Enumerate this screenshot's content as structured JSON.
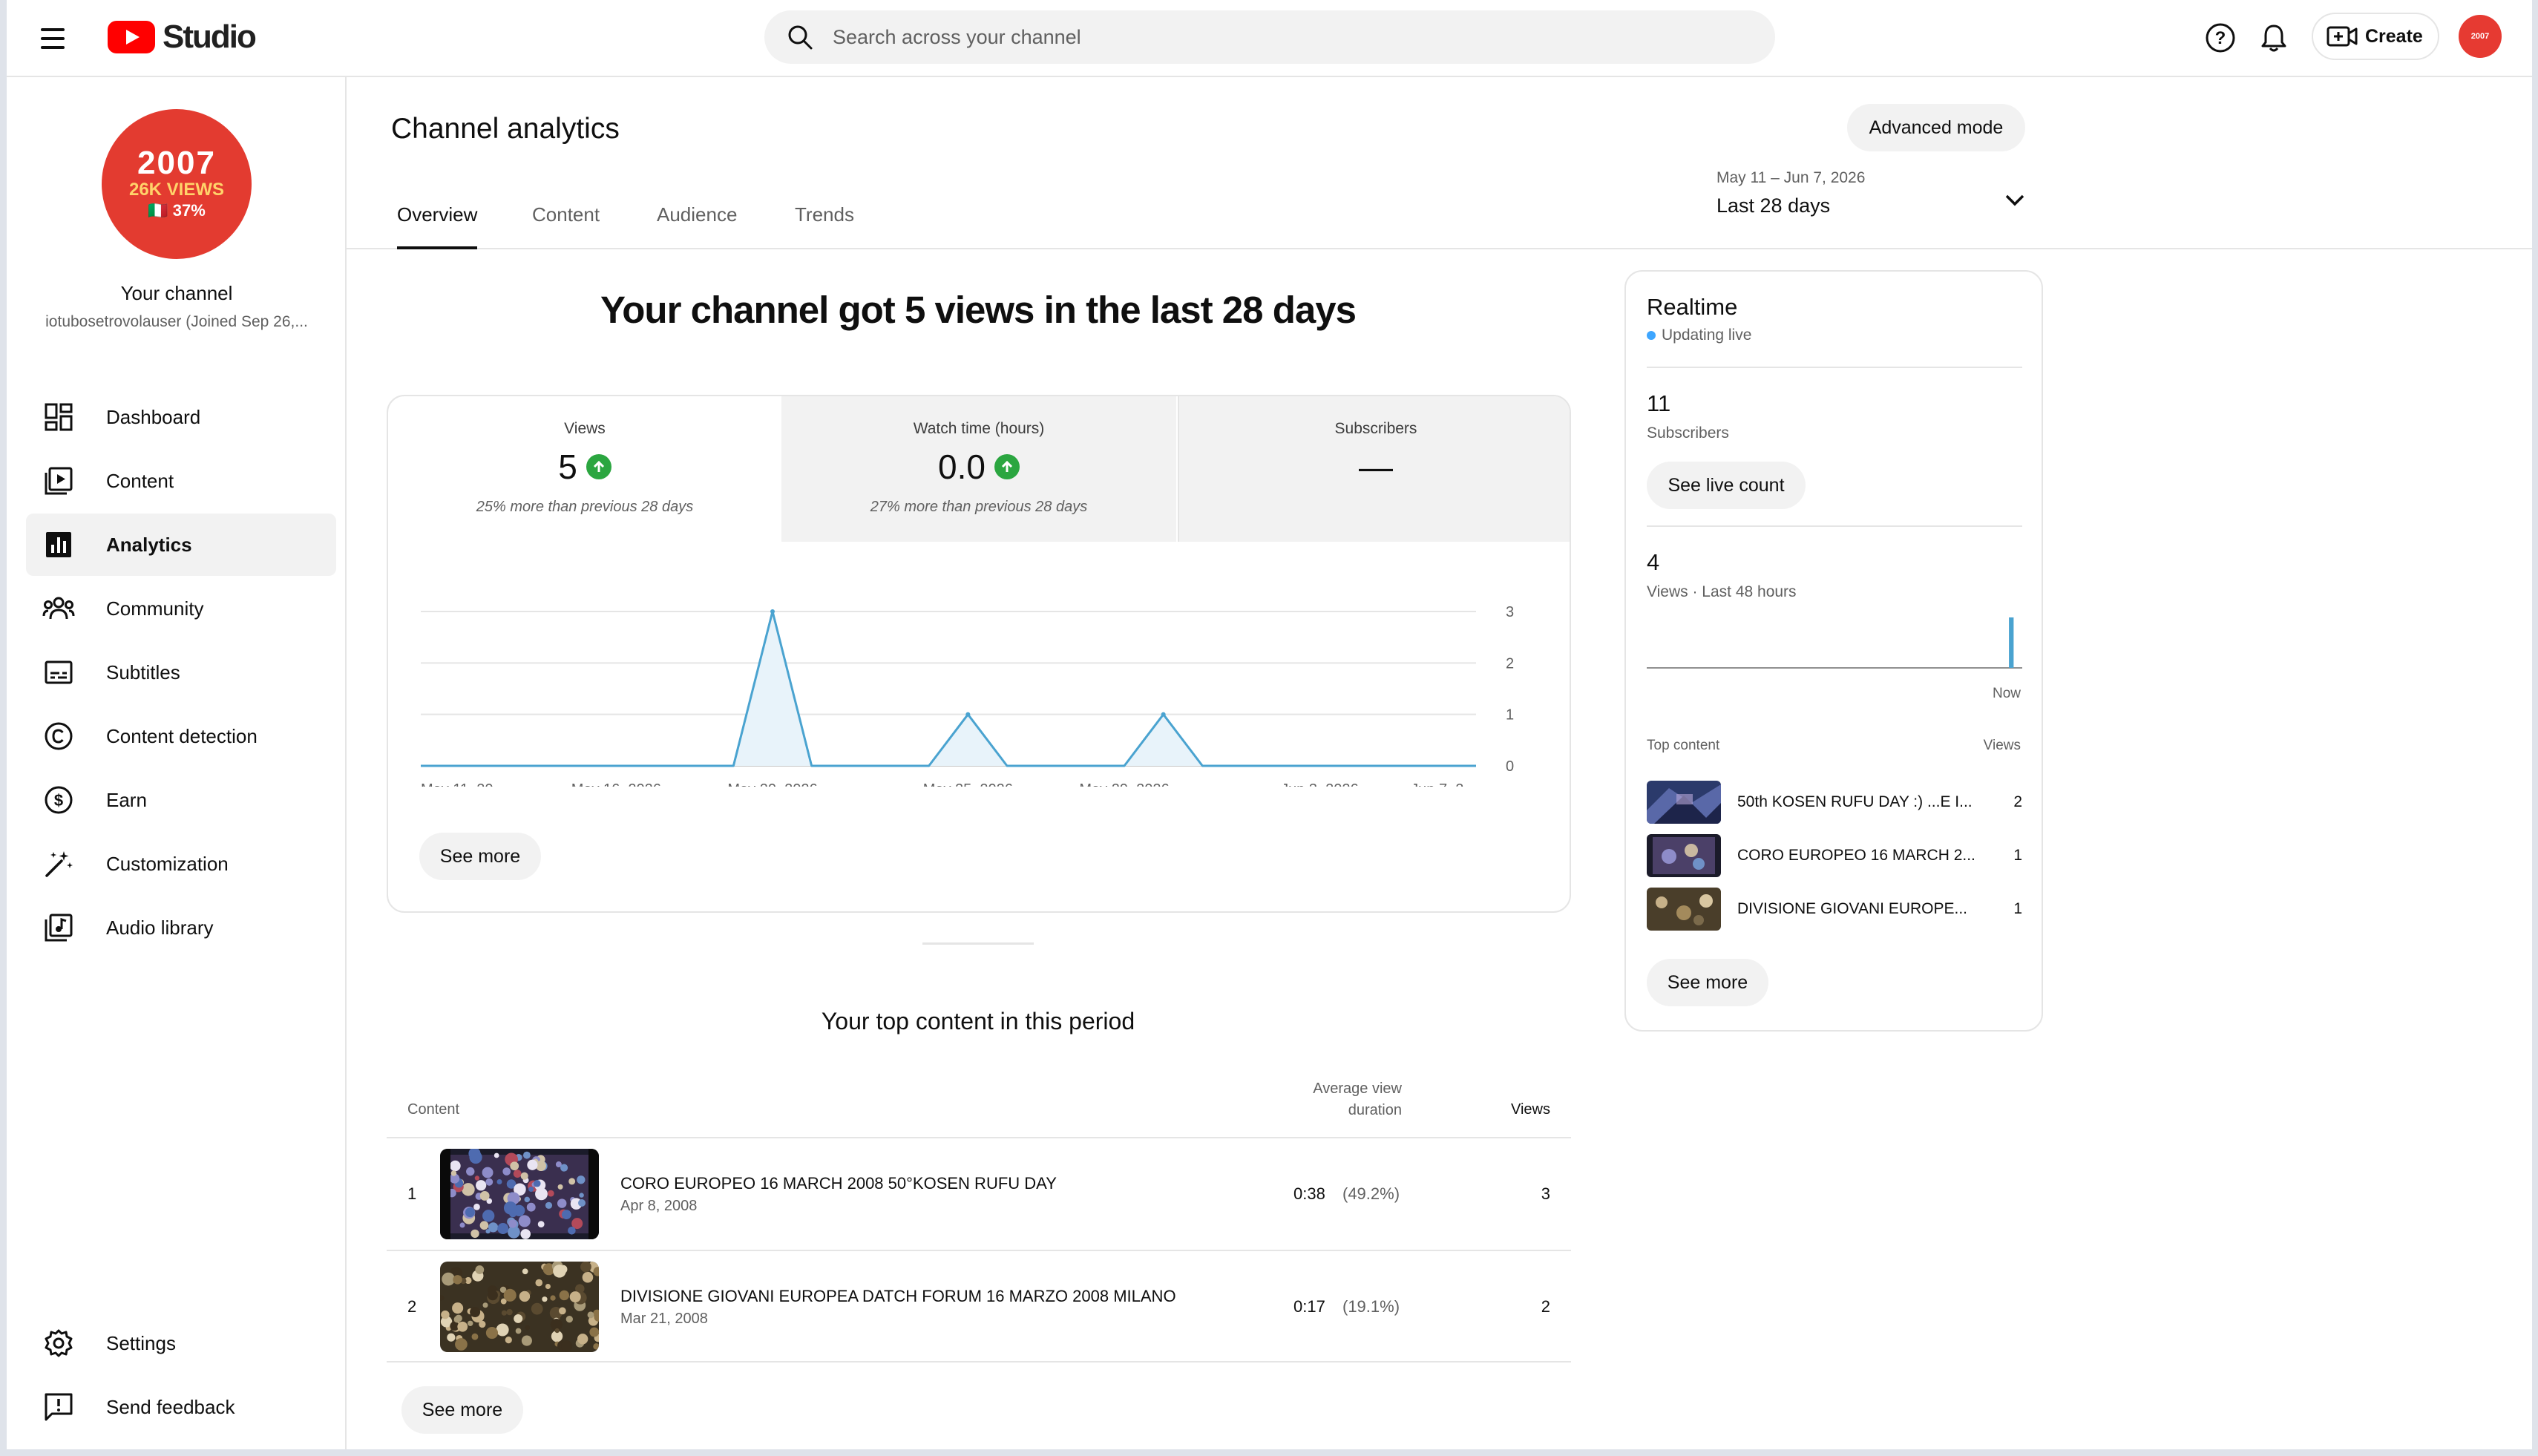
{
  "header": {
    "brand": "Studio",
    "search_placeholder": "Search across your channel",
    "create_label": "Create",
    "avatar_text": "2007"
  },
  "sidebar": {
    "avatar": {
      "line1": "2007",
      "line2": "26K VIEWS",
      "line3": "🇮🇹 37%"
    },
    "channel_title": "Your channel",
    "channel_handle": "iotubosetrovolauser (Joined Sep 26,...",
    "items": [
      {
        "label": "Dashboard",
        "icon": "dashboard-icon"
      },
      {
        "label": "Content",
        "icon": "content-icon"
      },
      {
        "label": "Analytics",
        "icon": "analytics-icon",
        "active": true
      },
      {
        "label": "Community",
        "icon": "community-icon"
      },
      {
        "label": "Subtitles",
        "icon": "subtitles-icon"
      },
      {
        "label": "Content detection",
        "icon": "copyright-icon"
      },
      {
        "label": "Earn",
        "icon": "dollar-icon"
      },
      {
        "label": "Customization",
        "icon": "magic-wand-icon"
      },
      {
        "label": "Audio library",
        "icon": "audio-library-icon"
      }
    ],
    "bottom_items": [
      {
        "label": "Settings",
        "icon": "gear-icon"
      },
      {
        "label": "Send feedback",
        "icon": "feedback-icon"
      }
    ]
  },
  "page": {
    "title": "Channel analytics",
    "advanced_mode_label": "Advanced mode",
    "date_range": {
      "dates": "May 11 – Jun 7, 2026",
      "label": "Last 28 days"
    },
    "tabs": [
      "Overview",
      "Content",
      "Audience",
      "Trends"
    ],
    "headline": "Your channel got 5 views in the last 28 days"
  },
  "metrics": [
    {
      "label": "Views",
      "value": "5",
      "note": "25% more than previous 28 days",
      "trend": "up"
    },
    {
      "label": "Watch time (hours)",
      "value": "0.0",
      "note": "27% more than previous 28 days",
      "trend": "up"
    },
    {
      "label": "Subscribers",
      "value": "—",
      "note": ""
    }
  ],
  "chart_data": {
    "type": "line",
    "title": "",
    "xlabel": "",
    "ylabel": "",
    "x": [
      "May 11",
      "May 12",
      "May 13",
      "May 14",
      "May 15",
      "May 16",
      "May 17",
      "May 18",
      "May 19",
      "May 20",
      "May 21",
      "May 22",
      "May 23",
      "May 24",
      "May 25",
      "May 26",
      "May 27",
      "May 28",
      "May 29",
      "May 30",
      "May 31",
      "Jun 1",
      "Jun 2",
      "Jun 3",
      "Jun 4",
      "Jun 5",
      "Jun 6",
      "Jun 7"
    ],
    "series": [
      {
        "name": "",
        "values": [
          0,
          0,
          0,
          0,
          0,
          0,
          0,
          0,
          0,
          3,
          0,
          0,
          0,
          0,
          1,
          0,
          0,
          0,
          0,
          1,
          0,
          0,
          0,
          0,
          0,
          0,
          0,
          0
        ]
      }
    ],
    "x_tick_labels": [
      "May 11, 20...",
      "May 16, 2026",
      "May 20, 2026",
      "May 25, 2026",
      "May 29, 2026",
      "Jun 3, 2026",
      "Jun 7, 2..."
    ],
    "x_tick_indices": [
      0,
      5,
      9,
      14,
      18,
      23,
      27
    ],
    "y_ticks": [
      "0",
      "1",
      "2",
      "3"
    ],
    "ylim": [
      0,
      3
    ],
    "grid": true,
    "colors": {
      "line": "#4aa3d0",
      "fill": "#e8f3fa"
    }
  },
  "see_more_label": "See more",
  "top_content": {
    "title": "Your top content in this period",
    "headers": {
      "content": "Content",
      "avg_line1": "Average view",
      "avg_line2": "duration",
      "views": "Views"
    },
    "rows": [
      {
        "rank": "1",
        "title": "CORO EUROPEO 16 MARCH 2008 50°KOSEN RUFU DAY",
        "date": "Apr 8, 2008",
        "duration": "0:38",
        "percent": "(49.2%)",
        "views": "3"
      },
      {
        "rank": "2",
        "title": "DIVISIONE GIOVANI EUROPEA DATCH FORUM 16 MARZO 2008 MILANO",
        "date": "Mar 21, 2008",
        "duration": "0:17",
        "percent": "(19.1%)",
        "views": "2"
      }
    ]
  },
  "realtime": {
    "title": "Realtime",
    "live_label": "Updating live",
    "subscribers_value": "11",
    "subscribers_label": "Subscribers",
    "see_live_count_label": "See live count",
    "views_value": "4",
    "views_label": "Views · Last 48 hours",
    "now_label": "Now",
    "views_48h": [
      0,
      0,
      0,
      0,
      0,
      0,
      0,
      0,
      0,
      0,
      0,
      0,
      0,
      0,
      0,
      0,
      0,
      0,
      0,
      0,
      0,
      0,
      0,
      0,
      0,
      0,
      0,
      0,
      0,
      0,
      0,
      0,
      0,
      0,
      0,
      0,
      0,
      0,
      0,
      0,
      0,
      0,
      0,
      0,
      0,
      0,
      4,
      0
    ],
    "top_content_label": "Top content",
    "views_header": "Views",
    "items": [
      {
        "title": "50th KOSEN RUFU DAY :) ...E I...",
        "views": "2"
      },
      {
        "title": "CORO EUROPEO 16 MARCH 2...",
        "views": "1"
      },
      {
        "title": "DIVISIONE GIOVANI EUROPE...",
        "views": "1"
      }
    ]
  }
}
